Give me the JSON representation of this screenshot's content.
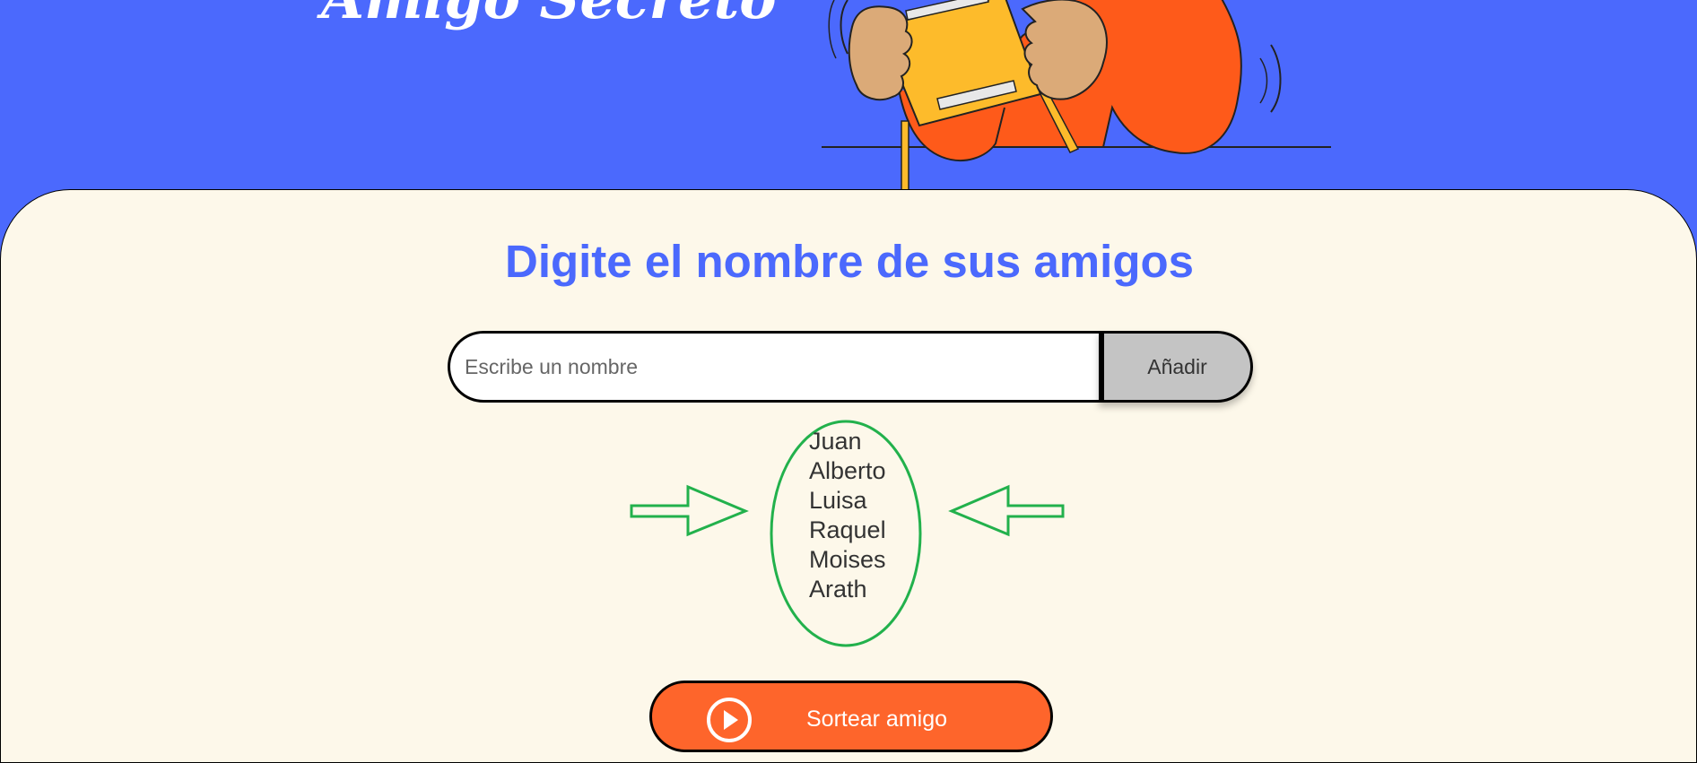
{
  "header": {
    "title": "Amigo Secreto"
  },
  "main": {
    "heading": "Digite el nombre de sus amigos",
    "input": {
      "placeholder": "Escribe un nombre",
      "value": ""
    },
    "add_button_label": "Añadir",
    "friends": [
      "Juan",
      "Alberto",
      "Luisa",
      "Raquel",
      "Moises",
      "Arath"
    ],
    "draw_button_label": "Sortear amigo",
    "draw_button_icon": "play-circle-icon"
  },
  "colors": {
    "header_bg": "#4b69fd",
    "main_bg": "#fdf8ea",
    "accent": "#4b69fd",
    "draw_button": "#fe652b",
    "add_button": "#c4c4c4",
    "annotation": "#22b14c"
  }
}
